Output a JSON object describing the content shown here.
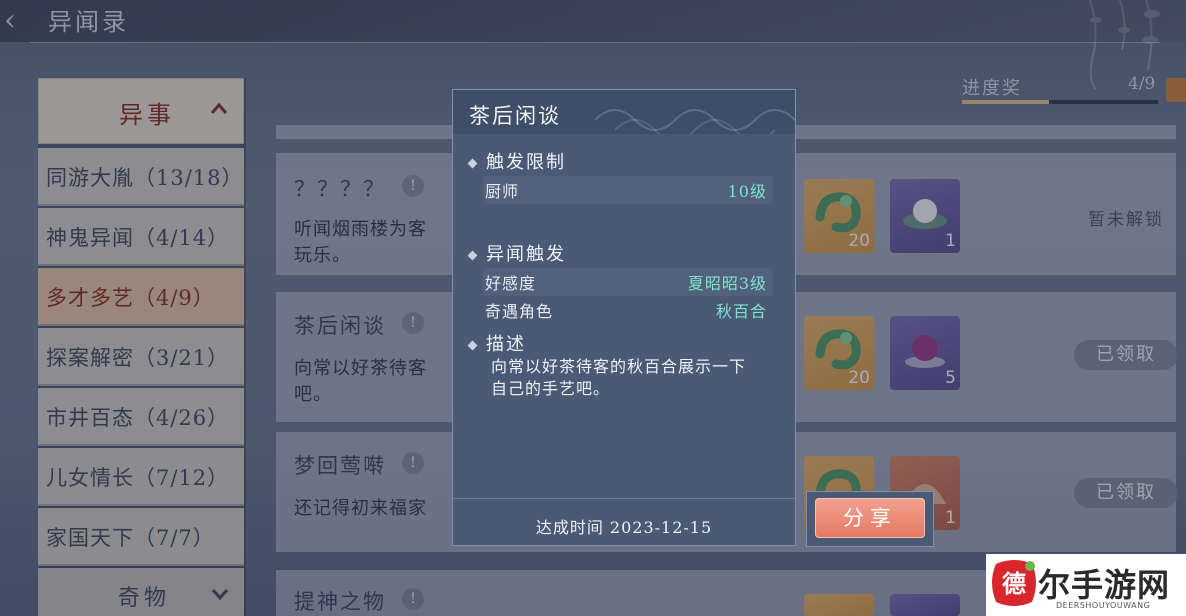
{
  "header": {
    "title": "异闻录"
  },
  "sidebar": {
    "category_open": "异事",
    "items": [
      {
        "label": "同游大胤（13/18）"
      },
      {
        "label": "神鬼异闻（4/14）"
      },
      {
        "label": "多才多艺（4/9）"
      },
      {
        "label": "探案解密（3/21）"
      },
      {
        "label": "市井百态（4/26）"
      },
      {
        "label": "儿女情长（7/12）"
      },
      {
        "label": "家国天下（7/7）"
      }
    ],
    "active_index": 2,
    "category_next": "奇物"
  },
  "progress": {
    "label": "进度奖",
    "count": "4/9",
    "fraction": 0.444
  },
  "cards": [
    {
      "title": "？？？？",
      "desc_line1": "听闻烟雨楼为客",
      "desc_line2": "玩乐。",
      "reward1_qty": "20",
      "reward2_qty": "1",
      "status": "暂未解锁"
    },
    {
      "title": "茶后闲谈",
      "desc_line1": "向常以好茶待客",
      "desc_line2": "吧。",
      "reward1_qty": "20",
      "reward2_qty": "5",
      "status": "已领取"
    },
    {
      "title": "梦回莺啭",
      "desc_line1": "还记得初来福家",
      "reward2_qty": "1",
      "status": "已领取"
    },
    {
      "title": "提神之物"
    }
  ],
  "popup": {
    "title": "茶后闲谈",
    "section_limit": "触发限制",
    "limit_rows": [
      {
        "key": "厨师",
        "value": "10级"
      }
    ],
    "section_trigger": "异闻触发",
    "trigger_rows": [
      {
        "key": "好感度",
        "value": "夏昭昭3级"
      },
      {
        "key": "奇遇角色",
        "value": "秋百合"
      }
    ],
    "section_desc": "描述",
    "desc_line1": "向常以好茶待客的秋百合展示一下",
    "desc_line2": "自己的手艺吧。",
    "achieved": "达成时间 2023-12-15"
  },
  "share": {
    "label": "分享"
  },
  "watermark": {
    "text": "尔手游网",
    "sub": "DEERSHOUYOUWANG",
    "seal": "德"
  },
  "colors": {
    "accent_teal": "#7fe3cf",
    "share_button": "#e47963",
    "active_item": "#e4c6a6"
  }
}
